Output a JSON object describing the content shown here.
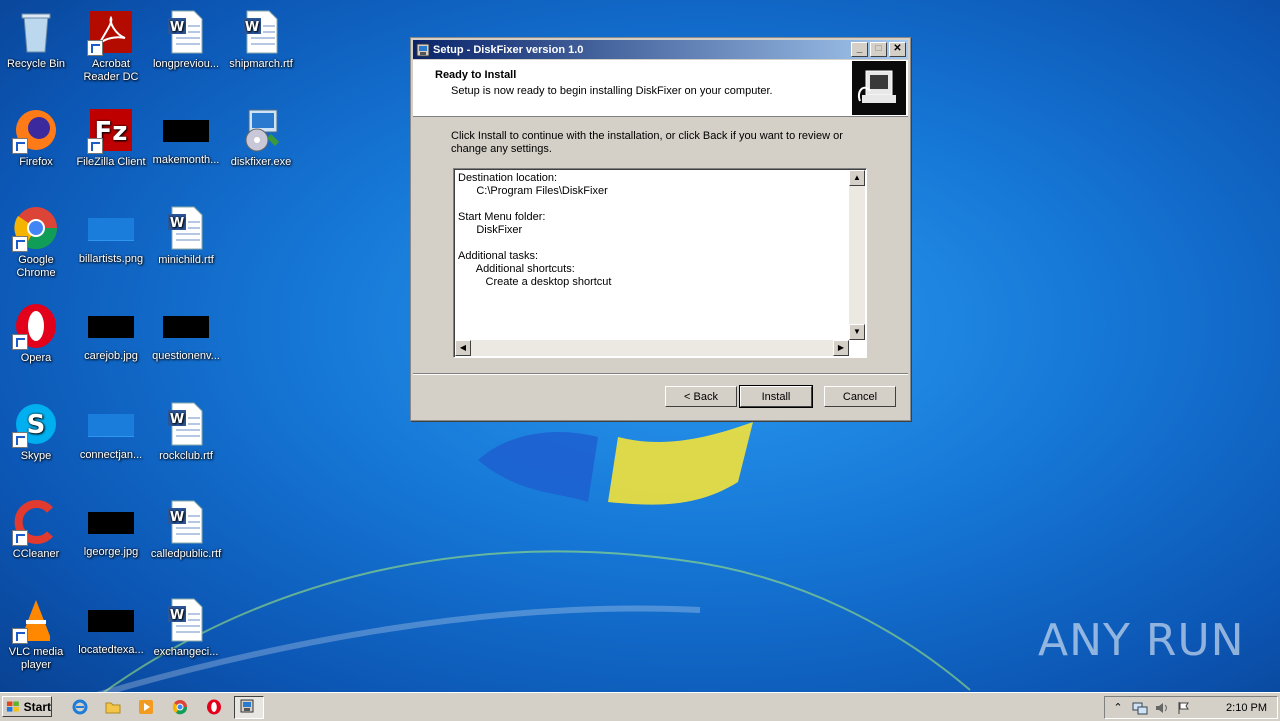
{
  "desktop": {
    "icons": [
      {
        "label": "Recycle Bin"
      },
      {
        "label": "Acrobat Reader DC"
      },
      {
        "label": "longpreviou..."
      },
      {
        "label": "shipmarch.rtf"
      },
      {
        "label": "Firefox"
      },
      {
        "label": "FileZilla Client"
      },
      {
        "label": "makemonth..."
      },
      {
        "label": "diskfixer.exe"
      },
      {
        "label": "Google Chrome"
      },
      {
        "label": "billartists.png"
      },
      {
        "label": "minichild.rtf"
      },
      {
        "label": "Opera"
      },
      {
        "label": "carejob.jpg"
      },
      {
        "label": "questionenv..."
      },
      {
        "label": "Skype"
      },
      {
        "label": "connectjan..."
      },
      {
        "label": "rockclub.rtf"
      },
      {
        "label": "CCleaner"
      },
      {
        "label": "lgeorge.jpg"
      },
      {
        "label": "calledpublic.rtf"
      },
      {
        "label": "VLC media player"
      },
      {
        "label": "locatedtexa..."
      },
      {
        "label": "exchangeci..."
      }
    ],
    "watermark": "ANY RUN"
  },
  "dialog": {
    "title": "Setup - DiskFixer version 1.0",
    "heading": "Ready to Install",
    "subheading": "Setup is now ready to begin installing DiskFixer on your computer.",
    "instructions": "Click Install to continue with the installation, or click Back if you want to review or change any settings.",
    "summary": "Destination location:\n      C:\\Program Files\\DiskFixer\n\nStart Menu folder:\n      DiskFixer\n\nAdditional tasks:\n      Additional shortcuts:\n         Create a desktop shortcut",
    "back_label": "< Back",
    "install_label": "Install",
    "cancel_label": "Cancel",
    "minimize_glyph": "_",
    "maximize_glyph": "□",
    "close_glyph": "✕"
  },
  "taskbar": {
    "start_label": "Start",
    "clock": "2:10 PM"
  },
  "colors": {
    "title_active_start": "#0a246a",
    "title_active_end": "#a6caf0",
    "dialog_face": "#d4d0c8"
  }
}
